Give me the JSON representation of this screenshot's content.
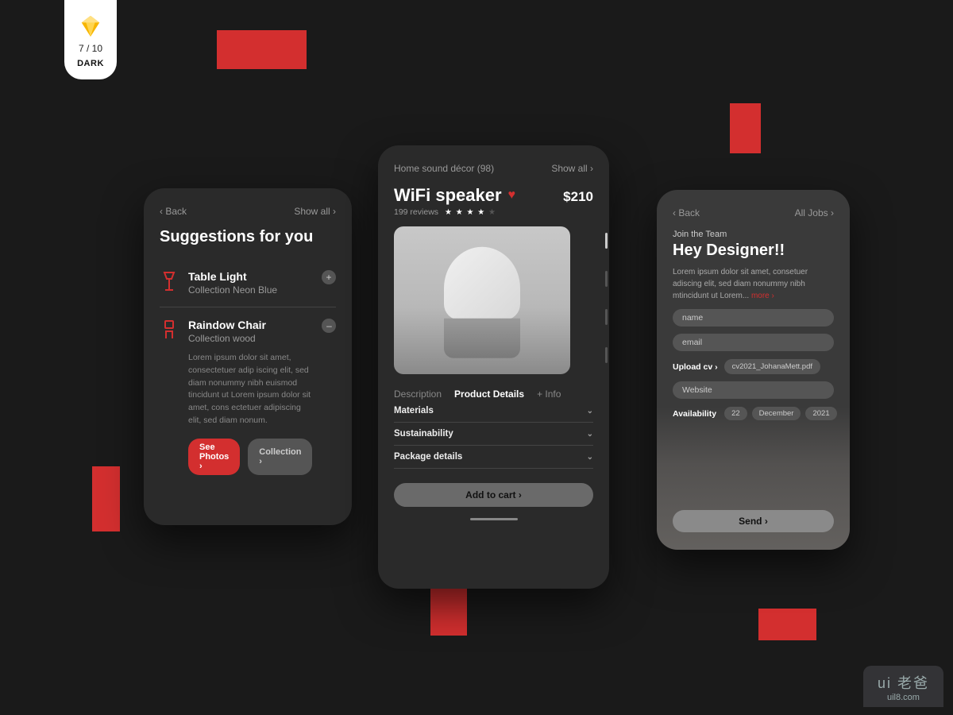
{
  "badge": {
    "count": "7 / 10",
    "mode": "DARK"
  },
  "card1": {
    "back": "‹ Back",
    "showall": "Show all ›",
    "title": "Suggestions for you",
    "items": [
      {
        "name": "Table Light",
        "sub": "Collection Neon Blue",
        "btn": "+"
      },
      {
        "name": "Raindow Chair",
        "sub": "Collection wood",
        "btn": "–"
      }
    ],
    "desc": "Lorem ipsum dolor sit amet, consectetuer adip iscing elit, sed diam nonummy nibh euismod tincidunt ut Lorem ipsum dolor sit amet, cons ectetuer adipiscing elit, sed diam nonum.",
    "photos": "See Photos ›",
    "collection": "Collection ›"
  },
  "card2": {
    "crumb": "Home sound décor (98)",
    "showall": "Show all ›",
    "name": "WiFi speaker",
    "price": "$210",
    "reviews": "199 reviews",
    "rating": 4,
    "tabs": {
      "desc": "Description",
      "details": "Product Details",
      "info": "+ Info"
    },
    "accordion": [
      "Materials",
      "Sustainability",
      "Package details"
    ],
    "cart": "Add to cart  ›"
  },
  "card3": {
    "back": "‹ Back",
    "alljobs": "All Jobs ›",
    "join": "Join the Team",
    "title": "Hey Designer!!",
    "desc": "Lorem ipsum dolor sit amet, consetuer adiscing elit, sed diam nonummy nibh mtincidunt ut Lorem...",
    "more": "more ›",
    "fields": {
      "name": "name",
      "email": "email",
      "website": "Website"
    },
    "upload_label": "Upload cv ›",
    "upload_file": "cv2021_JohanaMett.pdf",
    "avail_label": "Availability",
    "avail": {
      "day": "22",
      "month": "December",
      "year": "2021"
    },
    "send": "Send  ›"
  },
  "watermark": {
    "brand": "ui 老爸",
    "url": "uil8.com"
  }
}
